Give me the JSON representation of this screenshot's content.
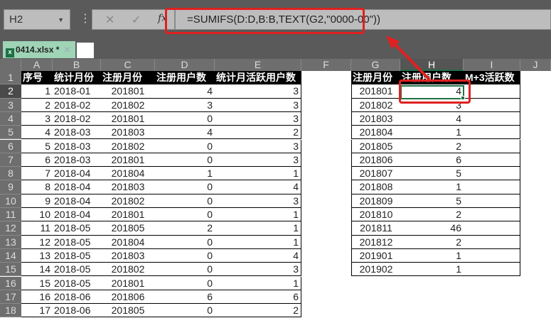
{
  "formula_bar": {
    "name_box": "H2",
    "cancel_icon": "✕",
    "enter_icon": "✓",
    "fx_label": "fx",
    "formula": "=SUMIFS(D:D,B:B,TEXT(G2,\"0000-00\"))"
  },
  "tab": {
    "file_name": "0414.xlsx *",
    "close": "✕",
    "icon": "x"
  },
  "columns": [
    "A",
    "B",
    "C",
    "D",
    "E",
    "F",
    "G",
    "H",
    "I",
    "J"
  ],
  "row_numbers": [
    "1",
    "2",
    "3",
    "4",
    "5",
    "6",
    "7",
    "8",
    "9",
    "10",
    "11",
    "12",
    "13",
    "14",
    "15",
    "16",
    "17",
    "18"
  ],
  "left_table": {
    "headers": [
      "序号",
      "统计月份",
      "注册月份",
      "注册用户数",
      "统计月活跃用户数"
    ],
    "rows": [
      [
        "1",
        "2018-01",
        "201801",
        "4",
        "3"
      ],
      [
        "2",
        "2018-02",
        "201802",
        "3",
        "3"
      ],
      [
        "3",
        "2018-02",
        "201801",
        "0",
        "3"
      ],
      [
        "4",
        "2018-03",
        "201803",
        "4",
        "2"
      ],
      [
        "5",
        "2018-03",
        "201802",
        "0",
        "3"
      ],
      [
        "6",
        "2018-03",
        "201801",
        "0",
        "3"
      ],
      [
        "7",
        "2018-04",
        "201804",
        "1",
        "1"
      ],
      [
        "8",
        "2018-04",
        "201803",
        "0",
        "4"
      ],
      [
        "9",
        "2018-04",
        "201802",
        "0",
        "3"
      ],
      [
        "10",
        "2018-04",
        "201801",
        "0",
        "1"
      ],
      [
        "11",
        "2018-05",
        "201805",
        "2",
        "1"
      ],
      [
        "12",
        "2018-05",
        "201804",
        "0",
        "1"
      ],
      [
        "13",
        "2018-05",
        "201803",
        "0",
        "4"
      ],
      [
        "14",
        "2018-05",
        "201802",
        "0",
        "3"
      ],
      [
        "15",
        "2018-05",
        "201801",
        "0",
        "1"
      ],
      [
        "16",
        "2018-06",
        "201806",
        "6",
        "6"
      ],
      [
        "17",
        "2018-06",
        "201805",
        "0",
        "2"
      ]
    ]
  },
  "right_table": {
    "headers": [
      "注册月份",
      "注册用户数",
      "M+3活跃数"
    ],
    "rows": [
      [
        "201801",
        "4",
        ""
      ],
      [
        "201802",
        "3",
        ""
      ],
      [
        "201803",
        "4",
        ""
      ],
      [
        "201804",
        "1",
        ""
      ],
      [
        "201805",
        "2",
        ""
      ],
      [
        "201806",
        "6",
        ""
      ],
      [
        "201807",
        "5",
        ""
      ],
      [
        "201808",
        "1",
        ""
      ],
      [
        "201809",
        "5",
        ""
      ],
      [
        "201810",
        "2",
        ""
      ],
      [
        "201811",
        "46",
        ""
      ],
      [
        "201812",
        "2",
        ""
      ],
      [
        "201901",
        "1",
        ""
      ],
      [
        "201902",
        "1",
        ""
      ]
    ]
  },
  "selected_cell": "H2",
  "highlight_color": "#e02020"
}
